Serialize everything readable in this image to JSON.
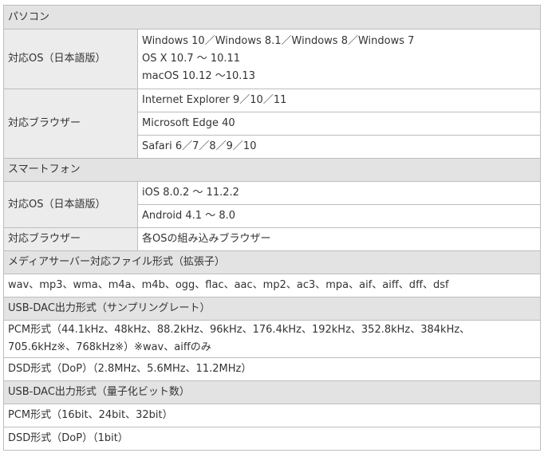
{
  "sections": {
    "pc": "パソコン",
    "smartphone": "スマートフォン",
    "media_server": "メディアサーバー対応ファイル形式（拡張子）",
    "usb_dac_rate": "USB-DAC出力形式（サンプリングレート）",
    "usb_dac_bit": "USB-DAC出力形式（量子化ビット数）"
  },
  "pc": {
    "os_label": "対応OS（日本語版）",
    "os_values": [
      "Windows 10／Windows 8.1／Windows 8／Windows 7",
      "OS X 10.7 ～ 10.11",
      "macOS 10.12 ～10.13"
    ],
    "browser_label": "対応ブラウザー",
    "browser_values": [
      "Internet Explorer 9／10／11",
      "Microsoft Edge 40",
      "Safari 6／7／8／9／10"
    ]
  },
  "smartphone": {
    "os_label": "対応OS（日本語版）",
    "os_values": [
      "iOS 8.0.2 ～ 11.2.2",
      "Android 4.1 ～ 8.0"
    ],
    "browser_label": "対応ブラウザー",
    "browser_value": "各OSの組み込みブラウザー"
  },
  "media_server": {
    "value": "wav、mp3、wma、m4a、m4b、ogg、flac、aac、mp2、ac3、mpa、aif、aiff、dff、dsf"
  },
  "usb_dac_rate": {
    "pcm_lines": [
      "PCM形式（44.1kHz、48kHz、88.2kHz、96kHz、176.4kHz、192kHz、352.8kHz、384kHz、",
      "705.6kHz※、768kHz※）※wav、aiffのみ"
    ],
    "dsd": "DSD形式（DoP）（2.8MHz、5.6MHz、11.2MHz）"
  },
  "usb_dac_bit": {
    "pcm": "PCM形式（16bit、24bit、32bit）",
    "dsd": "DSD形式（DoP）（1bit）"
  }
}
